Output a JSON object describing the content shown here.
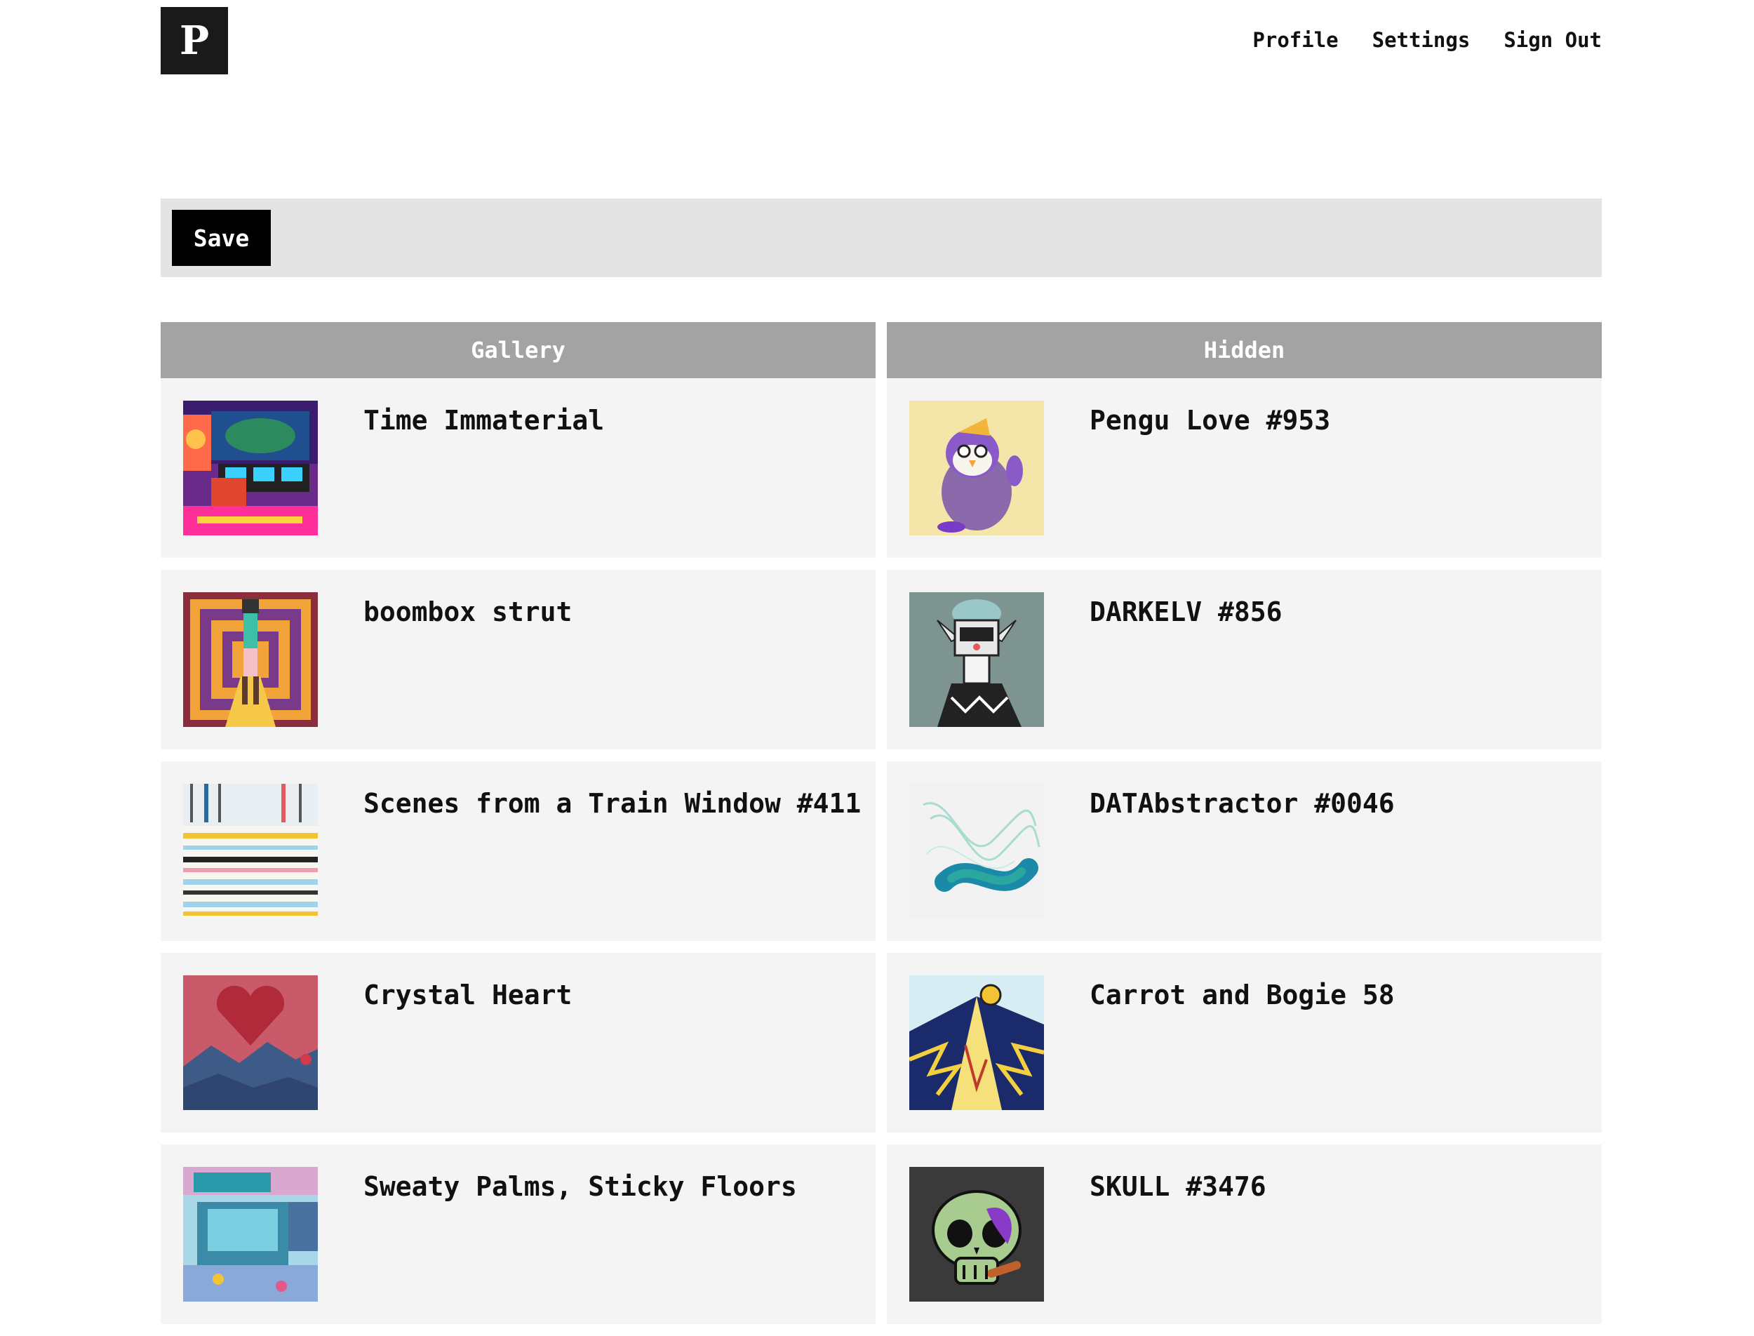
{
  "header": {
    "logo_letter": "P",
    "nav": [
      {
        "label": "Profile"
      },
      {
        "label": "Settings"
      },
      {
        "label": "Sign Out"
      }
    ]
  },
  "toolbar": {
    "save_label": "Save"
  },
  "gallery": {
    "title": "Gallery",
    "items": [
      {
        "title": "Time Immaterial",
        "thumb": "retro-room-art"
      },
      {
        "title": "boombox strut",
        "thumb": "boombox-corridor-art"
      },
      {
        "title": "Scenes from a Train Window #411",
        "thumb": "train-window-art"
      },
      {
        "title": "Crystal Heart",
        "thumb": "crystal-heart-art"
      },
      {
        "title": "Sweaty Palms, Sticky Floors",
        "thumb": "arcade-art"
      }
    ]
  },
  "hidden": {
    "title": "Hidden",
    "items": [
      {
        "title": "Pengu Love #953",
        "thumb": "penguin-art"
      },
      {
        "title": "DARKELV #856",
        "thumb": "dark-elf-art"
      },
      {
        "title": "DATAbstractor #0046",
        "thumb": "abstract-ribbon-art"
      },
      {
        "title": "Carrot and Bogie 58",
        "thumb": "carrot-bogie-art"
      },
      {
        "title": "SKULL #3476",
        "thumb": "skull-art"
      }
    ]
  }
}
